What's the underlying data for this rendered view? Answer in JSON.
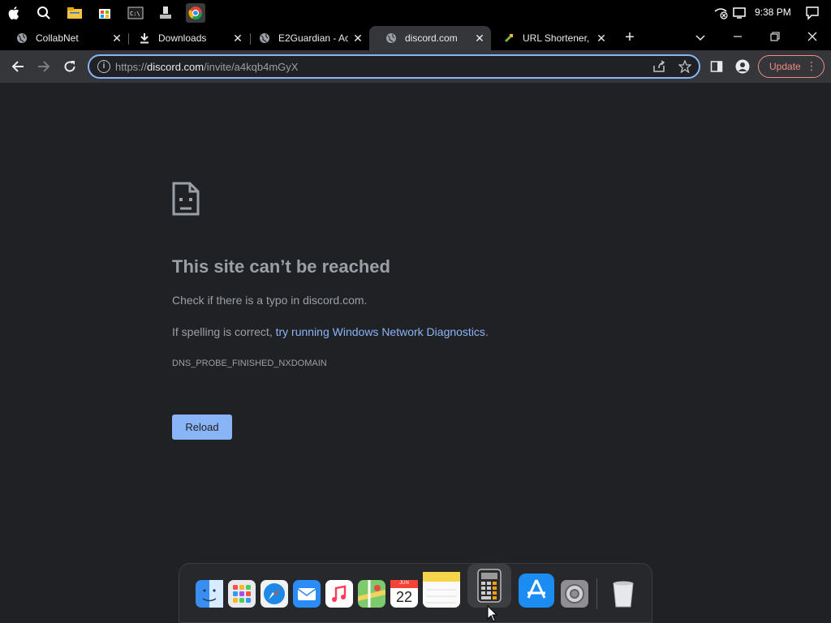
{
  "system_bar": {
    "time": "9:38 PM"
  },
  "tabs": [
    {
      "label": "CollabNet",
      "icon": "globe-icon"
    },
    {
      "label": "Downloads",
      "icon": "download-icon"
    },
    {
      "label": "E2Guardian - Ac",
      "icon": "globe-icon"
    },
    {
      "label": "discord.com",
      "icon": "globe-icon",
      "active": true
    },
    {
      "label": "URL Shortener, I",
      "icon": "link-icon"
    }
  ],
  "toolbar": {
    "url_scheme": "https://",
    "url_host": "discord.com",
    "url_path": "/invite/a4kqb4mGyX",
    "update_label": "Update"
  },
  "error_page": {
    "title": "This site can’t be reached",
    "line1": "Check if there is a typo in discord.com.",
    "line2_prefix": "If spelling is correct, ",
    "line2_link": "try running Windows Network Diagnostics",
    "line2_suffix": ".",
    "error_code": "DNS_PROBE_FINISHED_NXDOMAIN",
    "reload_label": "Reload"
  },
  "dock": {
    "calendar_month": "JUN",
    "calendar_day": "22"
  },
  "colors": {
    "page_bg": "#202124",
    "accent": "#8ab4f8",
    "update": "#f28b82"
  }
}
